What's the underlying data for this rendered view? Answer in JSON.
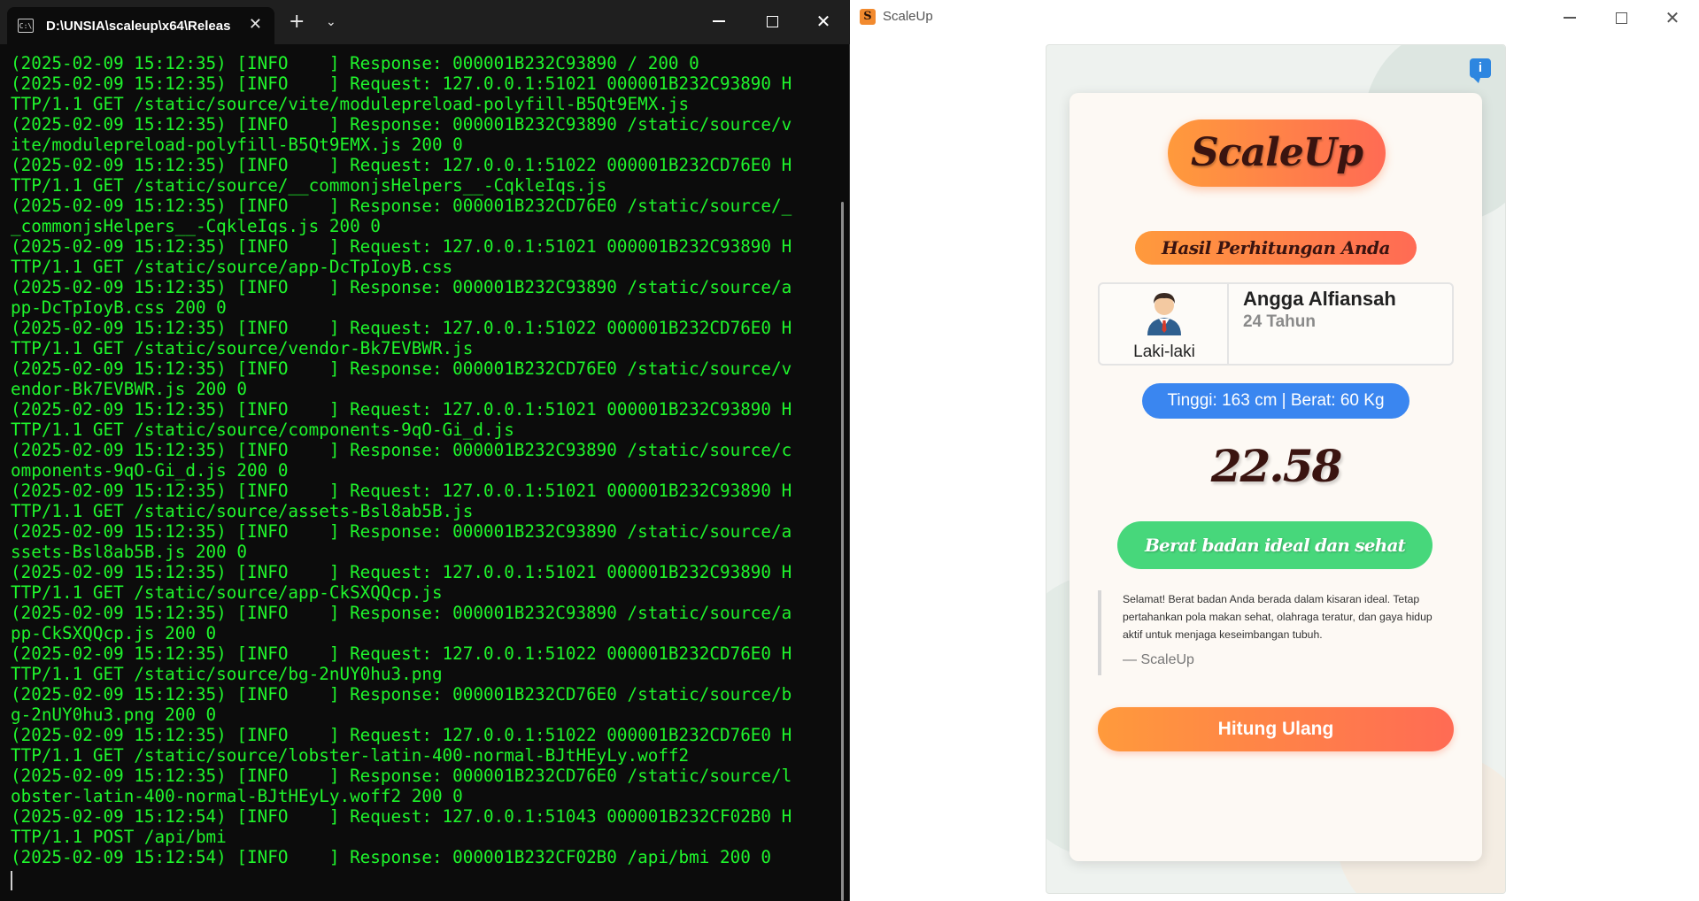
{
  "terminal": {
    "tab_title": "D:\\UNSIA\\scaleup\\x64\\Releas",
    "tab_icon": "C:\\",
    "new_tab_label": "+",
    "dropdown_label": "⌄",
    "close_tab_label": "✕",
    "lines": [
      "(2025-02-09 15:12:35) [INFO    ] Response: 000001B232C93890 / 200 0",
      "(2025-02-09 15:12:35) [INFO    ] Request: 127.0.0.1:51021 000001B232C93890 H",
      "TTP/1.1 GET /static/source/vite/modulepreload-polyfill-B5Qt9EMX.js",
      "(2025-02-09 15:12:35) [INFO    ] Response: 000001B232C93890 /static/source/v",
      "ite/modulepreload-polyfill-B5Qt9EMX.js 200 0",
      "(2025-02-09 15:12:35) [INFO    ] Request: 127.0.0.1:51022 000001B232CD76E0 H",
      "TTP/1.1 GET /static/source/__commonjsHelpers__-CqkleIqs.js",
      "(2025-02-09 15:12:35) [INFO    ] Response: 000001B232CD76E0 /static/source/_",
      "_commonjsHelpers__-CqkleIqs.js 200 0",
      "(2025-02-09 15:12:35) [INFO    ] Request: 127.0.0.1:51021 000001B232C93890 H",
      "TTP/1.1 GET /static/source/app-DcTpIoyB.css",
      "(2025-02-09 15:12:35) [INFO    ] Response: 000001B232C93890 /static/source/a",
      "pp-DcTpIoyB.css 200 0",
      "(2025-02-09 15:12:35) [INFO    ] Request: 127.0.0.1:51022 000001B232CD76E0 H",
      "TTP/1.1 GET /static/source/vendor-Bk7EVBWR.js",
      "(2025-02-09 15:12:35) [INFO    ] Response: 000001B232CD76E0 /static/source/v",
      "endor-Bk7EVBWR.js 200 0",
      "(2025-02-09 15:12:35) [INFO    ] Request: 127.0.0.1:51021 000001B232C93890 H",
      "TTP/1.1 GET /static/source/components-9qO-Gi_d.js",
      "(2025-02-09 15:12:35) [INFO    ] Response: 000001B232C93890 /static/source/c",
      "omponents-9qO-Gi_d.js 200 0",
      "(2025-02-09 15:12:35) [INFO    ] Request: 127.0.0.1:51021 000001B232C93890 H",
      "TTP/1.1 GET /static/source/assets-Bsl8ab5B.js",
      "(2025-02-09 15:12:35) [INFO    ] Response: 000001B232C93890 /static/source/a",
      "ssets-Bsl8ab5B.js 200 0",
      "(2025-02-09 15:12:35) [INFO    ] Request: 127.0.0.1:51021 000001B232C93890 H",
      "TTP/1.1 GET /static/source/app-CkSXQQcp.js",
      "(2025-02-09 15:12:35) [INFO    ] Response: 000001B232C93890 /static/source/a",
      "pp-CkSXQQcp.js 200 0",
      "(2025-02-09 15:12:35) [INFO    ] Request: 127.0.0.1:51022 000001B232CD76E0 H",
      "TTP/1.1 GET /static/source/bg-2nUY0hu3.png",
      "(2025-02-09 15:12:35) [INFO    ] Response: 000001B232CD76E0 /static/source/b",
      "g-2nUY0hu3.png 200 0",
      "(2025-02-09 15:12:35) [INFO    ] Request: 127.0.0.1:51022 000001B232CD76E0 H",
      "TTP/1.1 GET /static/source/lobster-latin-400-normal-BJtHEyLy.woff2",
      "(2025-02-09 15:12:35) [INFO    ] Response: 000001B232CD76E0 /static/source/l",
      "obster-latin-400-normal-BJtHEyLy.woff2 200 0",
      "(2025-02-09 15:12:54) [INFO    ] Request: 127.0.0.1:51043 000001B232CF02B0 H",
      "TTP/1.1 POST /api/bmi",
      "(2025-02-09 15:12:54) [INFO    ] Response: 000001B232CF02B0 /api/bmi 200 0"
    ]
  },
  "app": {
    "window_title": "ScaleUp",
    "logo_letter": "S",
    "brand": "ScaleUp",
    "result_title": "Hasil Perhitungan Anda",
    "profile": {
      "gender": "Laki-laki",
      "name": "Angga Alfiansah",
      "age": "24 Tahun"
    },
    "height_weight": "Tinggi: 163 cm | Berat: 60 Kg",
    "bmi_value": "22.58",
    "status": "Berat badan ideal dan sehat",
    "quote_text": "Selamat! Berat badan Anda berada dalam kisaran ideal. Tetap pertahankan pola makan sehat, olahraga teratur, dan gaya hidup aktif untuk menjaga keseimbangan tubuh.",
    "quote_author": "— ScaleUp",
    "recalc_label": "Hitung Ulang",
    "info_label": "i"
  },
  "colors": {
    "terminal_text": "#1ff52c",
    "accent_orange": "#ff9a3c",
    "accent_red": "#ff6b54",
    "status_green": "#47d77b",
    "pill_blue": "#3a86f0"
  },
  "icons": [
    "cmd-icon",
    "close-icon",
    "plus-icon",
    "chevron-down-icon",
    "minimize-icon",
    "maximize-icon",
    "info-icon",
    "avatar-icon",
    "app-logo-icon"
  ]
}
